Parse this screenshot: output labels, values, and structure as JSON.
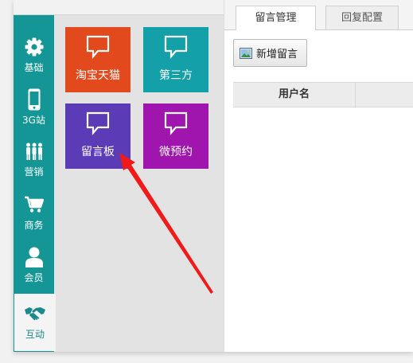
{
  "nav": {
    "items": [
      {
        "label": "基础",
        "icon": "gear-icon"
      },
      {
        "label": "3G站",
        "icon": "mobile-phone-icon"
      },
      {
        "label": "营销",
        "icon": "people-icon"
      },
      {
        "label": "商务",
        "icon": "shopping-cart-icon"
      },
      {
        "label": "会员",
        "icon": "user-icon"
      },
      {
        "label": "互动",
        "icon": "handshake-icon",
        "active": true
      }
    ]
  },
  "tiles": [
    {
      "label": "淘宝天猫",
      "icon": "speech-bubble-icon",
      "color": "#e2491c"
    },
    {
      "label": "第三方",
      "icon": "speech-bubble-icon",
      "color": "#14a0a8"
    },
    {
      "label": "留言板",
      "icon": "speech-bubble-icon",
      "color": "#5b3bb6"
    },
    {
      "label": "微预约",
      "icon": "speech-bubble-icon",
      "color": "#a015ad"
    }
  ],
  "tabs": [
    {
      "label": "留言管理",
      "active": true
    },
    {
      "label": "回复配置",
      "active": false
    }
  ],
  "toolbar": {
    "add_label": "新增留言"
  },
  "table": {
    "columns": [
      "用户名",
      ""
    ]
  },
  "colors": {
    "nav_bg": "#159696",
    "annotation_arrow": "#f01a1a"
  }
}
